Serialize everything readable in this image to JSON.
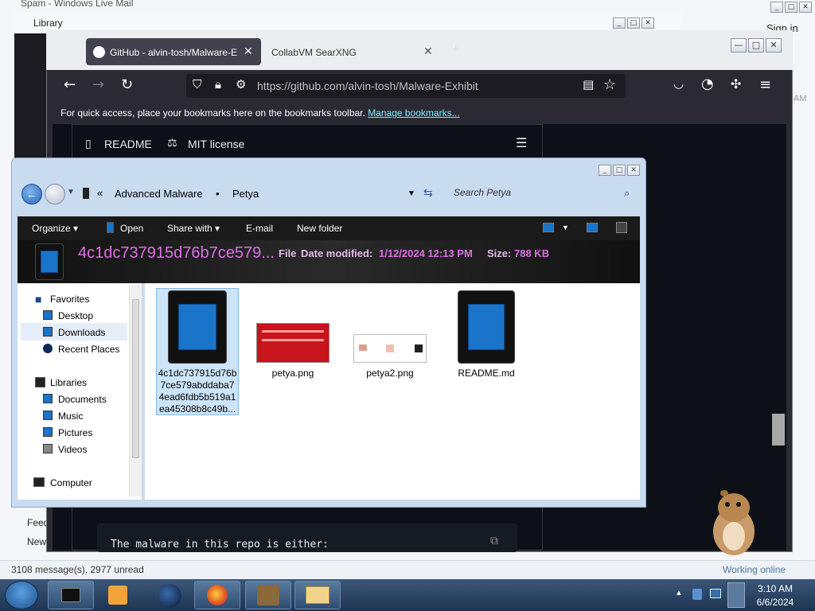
{
  "mail": {
    "title": "Spam - Windows Live Mail",
    "library_title": "Library",
    "sign_in": "Sign in",
    "am_fragment": "AM",
    "feeds": "Feeds",
    "news": "News",
    "status_messages": "3108 message(s), 2977 unread",
    "status_online": "Working online"
  },
  "firefox": {
    "tabs": [
      {
        "label": "GitHub - alvin-tosh/Malware-Exhibit",
        "close": "✕"
      },
      {
        "label": "CollabVM SearXNG",
        "close": "✕"
      }
    ],
    "new_tab": "+",
    "url": "https://github.com/alvin-tosh/Malware-Exhibit",
    "bookmarks_text": "For quick access, place your bookmarks here on the bookmarks toolbar. ",
    "bookmarks_link": "Manage bookmarks...",
    "window_buttons": {
      "min": "—",
      "max": "□",
      "close": "✕"
    }
  },
  "github": {
    "readme_tab": "README",
    "license_tab": "MIT license",
    "code_text": "The malware in this repo is either:"
  },
  "explorer": {
    "breadcrumb": [
      "Advanced Malware",
      "Petya"
    ],
    "search_placeholder": "Search Petya",
    "toolbar": {
      "organize": "Organize ▾",
      "open": "Open",
      "share_with": "Share with ▾",
      "email": "E-mail",
      "new_folder": "New folder"
    },
    "details": {
      "name": "4c1dc737915d76b7ce579...",
      "type": "File",
      "date_modified_label": "Date modified:",
      "date_modified": "1/12/2024 12:13 PM",
      "size_label": "Size:",
      "size": "788 KB"
    },
    "nav": {
      "favorites": "Favorites",
      "desktop": "Desktop",
      "downloads": "Downloads",
      "recent_places": "Recent Places",
      "libraries": "Libraries",
      "documents": "Documents",
      "music": "Music",
      "pictures": "Pictures",
      "videos": "Videos",
      "computer": "Computer"
    },
    "files": [
      {
        "name_lines": [
          "4c1dc737915d76b",
          "7ce579abddaba7",
          "4ead6fdb5b519a1",
          "ea45308b8c49b..."
        ],
        "icon": "tablet-icon"
      },
      {
        "name_lines": [
          "petya.png"
        ],
        "icon": "image-thumbnail"
      },
      {
        "name_lines": [
          "petya2.png"
        ],
        "icon": "image-thumbnail"
      },
      {
        "name_lines": [
          "README.md"
        ],
        "icon": "tablet-icon"
      }
    ]
  },
  "taskbar": {
    "time": "3:10 AM",
    "date": "6/6/2024"
  }
}
